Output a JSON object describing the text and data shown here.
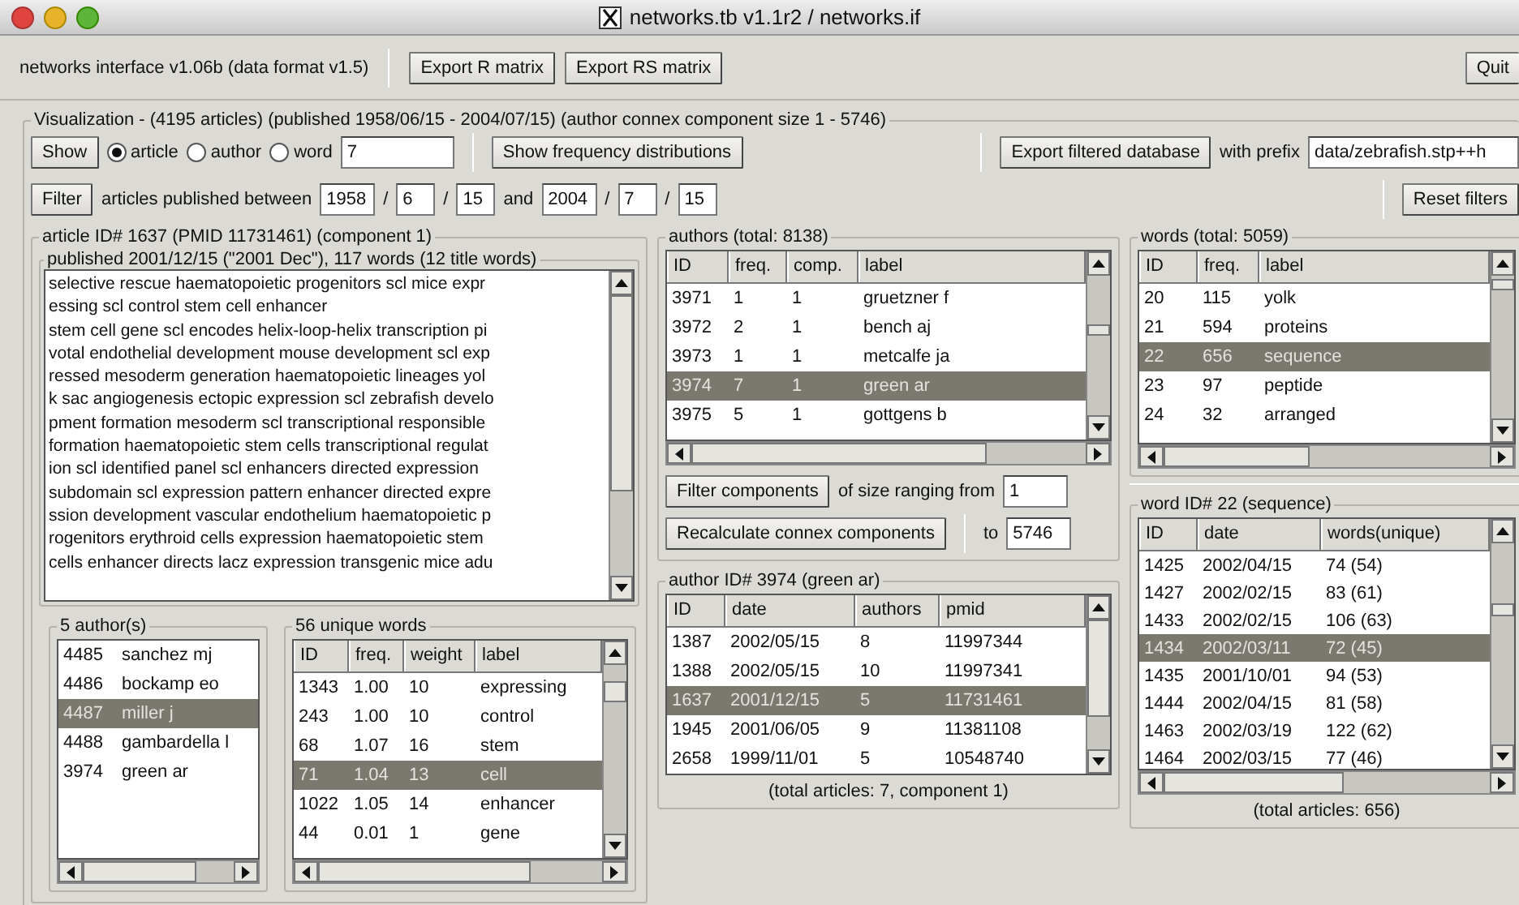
{
  "window": {
    "title": "networks.tb v1.1r2 / networks.if"
  },
  "toolbar": {
    "info": "networks interface v1.06b (data format v1.5)",
    "buttons": [
      "Export R matrix",
      "Export RS matrix"
    ],
    "quit": "Quit"
  },
  "visualization": {
    "legend": "Visualization - (4195 articles) (published 1958/06/15 - 2004/07/15) (author connex component size 1 - 5746)",
    "show_button": "Show",
    "radios": [
      {
        "label": "article",
        "selected": true
      },
      {
        "label": "author",
        "selected": false
      },
      {
        "label": "word",
        "selected": false
      }
    ],
    "radio_value": "7",
    "freq_button": "Show frequency distributions",
    "export_button": "Export filtered database",
    "prefix_label": "with prefix",
    "prefix_value": "data/zebrafish.stp++h",
    "filter_button": "Filter",
    "filter_label": "articles published between",
    "date_from": [
      "1958",
      "6",
      "15"
    ],
    "and_label": "and",
    "date_to": [
      "2004",
      "7",
      "15"
    ],
    "separator": "/",
    "reset_button": "Reset filters"
  },
  "article": {
    "legend": "article ID# 1637 (PMID 11731461) (component 1)",
    "published_legend": "published 2001/12/15 (\"2001 Dec\"), 117 words (12 title words)",
    "text_lines": [
      "selective rescue haematopoietic progenitors scl mice expr",
      "essing scl control stem cell enhancer",
      "stem cell gene scl encodes helix-loop-helix transcription pi",
      "votal endothelial development mouse development scl exp",
      "ressed mesoderm generation haematopoietic lineages yol",
      "k sac angiogenesis ectopic expression scl zebrafish develo",
      "pment formation mesoderm scl transcriptional responsible",
      "formation haematopoietic stem cells transcriptional regulat",
      "ion scl identified panel scl enhancers directed expression",
      "subdomain scl expression pattern enhancer directed expre",
      "ssion development vascular endothelium haematopoietic p",
      "rogenitors erythroid cells expression haematopoietic stem",
      "cells enhancer directs lacz expression transgenic mice adu"
    ],
    "authors": {
      "legend": "5 author(s)",
      "rows": [
        {
          "cells": [
            "4485",
            "sanchez mj"
          ],
          "selected": false
        },
        {
          "cells": [
            "4486",
            "bockamp eo"
          ],
          "selected": false
        },
        {
          "cells": [
            "4487",
            "miller j"
          ],
          "selected": true
        },
        {
          "cells": [
            "4488",
            "gambardella l"
          ],
          "selected": false
        },
        {
          "cells": [
            "3974",
            "green ar"
          ],
          "selected": false
        }
      ]
    },
    "words": {
      "legend": "56 unique words",
      "columns": [
        "ID",
        "freq.",
        "weight",
        "label"
      ],
      "rows": [
        {
          "cells": [
            "1343",
            "1.00",
            "10",
            "expressing"
          ],
          "selected": false
        },
        {
          "cells": [
            "243",
            "1.00",
            "10",
            "control"
          ],
          "selected": false
        },
        {
          "cells": [
            "68",
            "1.07",
            "16",
            "stem"
          ],
          "selected": false
        },
        {
          "cells": [
            "71",
            "1.04",
            "13",
            "cell"
          ],
          "selected": true
        },
        {
          "cells": [
            "1022",
            "1.05",
            "14",
            "enhancer"
          ],
          "selected": false
        },
        {
          "cells": [
            "44",
            "0.01",
            "1",
            "gene"
          ],
          "selected": false
        }
      ]
    }
  },
  "authors_panel": {
    "legend": "authors (total: 8138)",
    "columns": [
      "ID",
      "freq.",
      "comp.",
      "label"
    ],
    "rows": [
      {
        "cells": [
          "3971",
          "1",
          "1",
          "gruetzner f"
        ],
        "selected": false
      },
      {
        "cells": [
          "3972",
          "2",
          "1",
          "bench aj"
        ],
        "selected": false
      },
      {
        "cells": [
          "3973",
          "1",
          "1",
          "metcalfe ja"
        ],
        "selected": false
      },
      {
        "cells": [
          "3974",
          "7",
          "1",
          "green ar"
        ],
        "selected": true
      },
      {
        "cells": [
          "3975",
          "5",
          "1",
          "gottgens b"
        ],
        "selected": false
      }
    ]
  },
  "component_filter": {
    "filter_button": "Filter components",
    "range_label": "of size ranging from",
    "from_value": "1",
    "recalc_button": "Recalculate connex components",
    "to_label": "to",
    "to_value": "5746"
  },
  "author_detail": {
    "legend": "author ID# 3974 (green ar)",
    "columns": [
      "ID",
      "date",
      "authors",
      "pmid"
    ],
    "rows": [
      {
        "cells": [
          "1387",
          "2002/05/15",
          "8",
          "11997344"
        ],
        "selected": false
      },
      {
        "cells": [
          "1388",
          "2002/05/15",
          "10",
          "11997341"
        ],
        "selected": false
      },
      {
        "cells": [
          "1637",
          "2001/12/15",
          "5",
          "11731461"
        ],
        "selected": true
      },
      {
        "cells": [
          "1945",
          "2001/06/05",
          "9",
          "11381108"
        ],
        "selected": false
      },
      {
        "cells": [
          "2658",
          "1999/11/01",
          "5",
          "10548740"
        ],
        "selected": false
      }
    ],
    "footer": "(total articles: 7, component 1)"
  },
  "words_panel": {
    "legend": "words (total: 5059)",
    "columns": [
      "ID",
      "freq.",
      "label"
    ],
    "rows": [
      {
        "cells": [
          "20",
          "115",
          "yolk"
        ],
        "selected": false
      },
      {
        "cells": [
          "21",
          "594",
          "proteins"
        ],
        "selected": false
      },
      {
        "cells": [
          "22",
          "656",
          "sequence"
        ],
        "selected": true
      },
      {
        "cells": [
          "23",
          "97",
          "peptide"
        ],
        "selected": false
      },
      {
        "cells": [
          "24",
          "32",
          "arranged"
        ],
        "selected": false
      }
    ]
  },
  "word_detail": {
    "legend": "word ID# 22 (sequence)",
    "columns": [
      "ID",
      "date",
      "words(unique)"
    ],
    "rows": [
      {
        "cells": [
          "1425",
          "2002/04/15",
          "74 (54)"
        ],
        "selected": false
      },
      {
        "cells": [
          "1427",
          "2002/02/15",
          "83 (61)"
        ],
        "selected": false
      },
      {
        "cells": [
          "1433",
          "2002/02/15",
          "106 (63)"
        ],
        "selected": false
      },
      {
        "cells": [
          "1434",
          "2002/03/11",
          "72 (45)"
        ],
        "selected": true
      },
      {
        "cells": [
          "1435",
          "2001/10/01",
          "94 (53)"
        ],
        "selected": false
      },
      {
        "cells": [
          "1444",
          "2002/04/15",
          "81 (58)"
        ],
        "selected": false
      },
      {
        "cells": [
          "1463",
          "2002/03/19",
          "122 (62)"
        ],
        "selected": false
      },
      {
        "cells": [
          "1464",
          "2002/03/15",
          "77 (46)"
        ],
        "selected": false
      }
    ],
    "footer": "(total articles: 656)"
  }
}
